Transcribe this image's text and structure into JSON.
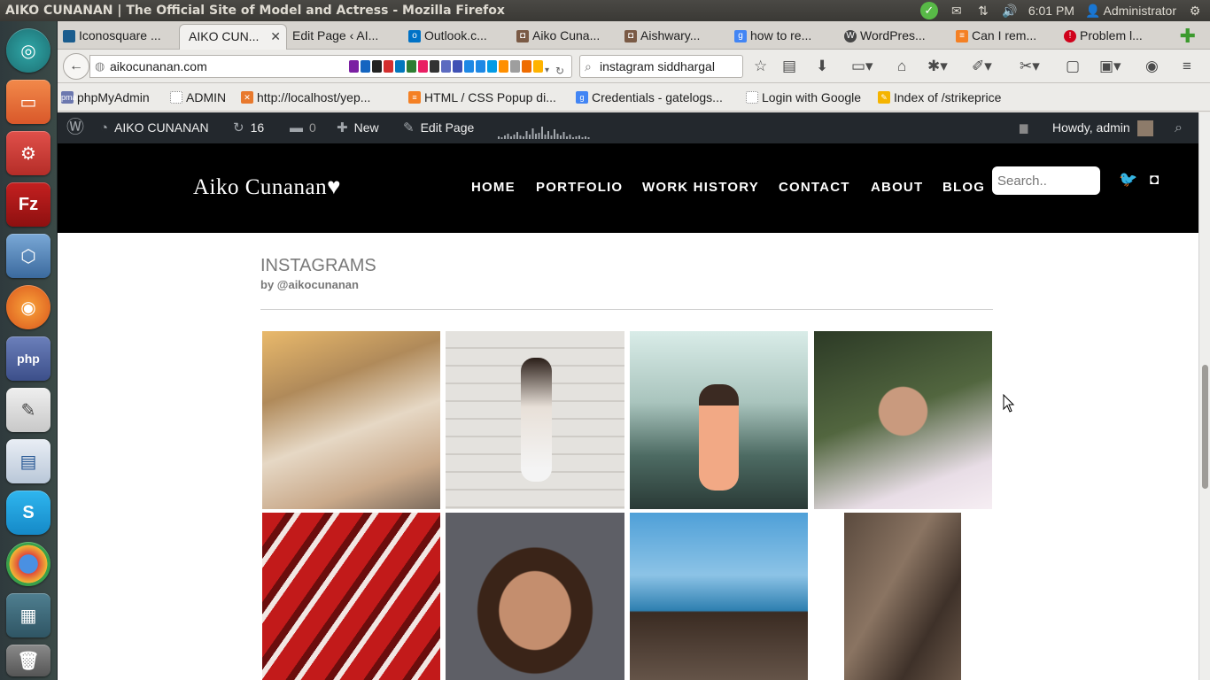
{
  "panel": {
    "window_title": "AIKO CUNANAN | The Official Site of Model and Actress - Mozilla Firefox",
    "time": "6:01 PM",
    "user": "Administrator"
  },
  "tabs": [
    {
      "label": "Iconosquare ...",
      "icon": "iconosquare-icon"
    },
    {
      "label": "AIKO CUN...",
      "icon": "site-icon",
      "active": true
    },
    {
      "label": "Edit Page ‹ AI...",
      "icon": "wordpress-icon"
    },
    {
      "label": "Outlook.c...",
      "icon": "outlook-icon"
    },
    {
      "label": "Aiko Cuna...",
      "icon": "instagram-icon"
    },
    {
      "label": "Aishwary...",
      "icon": "instagram-icon"
    },
    {
      "label": "how to re...",
      "icon": "google-icon"
    },
    {
      "label": "WordPres...",
      "icon": "wordpress-icon"
    },
    {
      "label": "Can I rem...",
      "icon": "stackoverflow-icon"
    },
    {
      "label": "Problem l...",
      "icon": "error-icon"
    }
  ],
  "navbar": {
    "url": "aikocunanan.com",
    "search_value": "instagram siddhargal"
  },
  "bookmarks": [
    {
      "label": "phpMyAdmin"
    },
    {
      "label": "ADMIN"
    },
    {
      "label": "http://localhost/yep..."
    },
    {
      "label": "HTML / CSS Popup di..."
    },
    {
      "label": "Credentials - gatelogs..."
    },
    {
      "label": "Login with Google"
    },
    {
      "label": "Index of /strikeprice"
    }
  ],
  "wpbar": {
    "site": "AIKO CUNANAN",
    "updates": "16",
    "comments": "0",
    "new": "New",
    "edit": "Edit Page",
    "howdy": "Howdy, admin"
  },
  "site": {
    "logo": "Aiko Cunanan",
    "logo_heart": "♥",
    "nav": [
      "HOME",
      "PORTFOLIO",
      "WORK HISTORY",
      "CONTACT",
      "ABOUT",
      "BLOG"
    ],
    "search_placeholder": "Search.."
  },
  "instagram": {
    "title": "INSTAGRAMS",
    "byline": "by @aikocunanan"
  },
  "colors": {
    "header_bg": "#000000",
    "wpbar_bg": "#23282d",
    "accent_green": "#3c9a2d"
  }
}
